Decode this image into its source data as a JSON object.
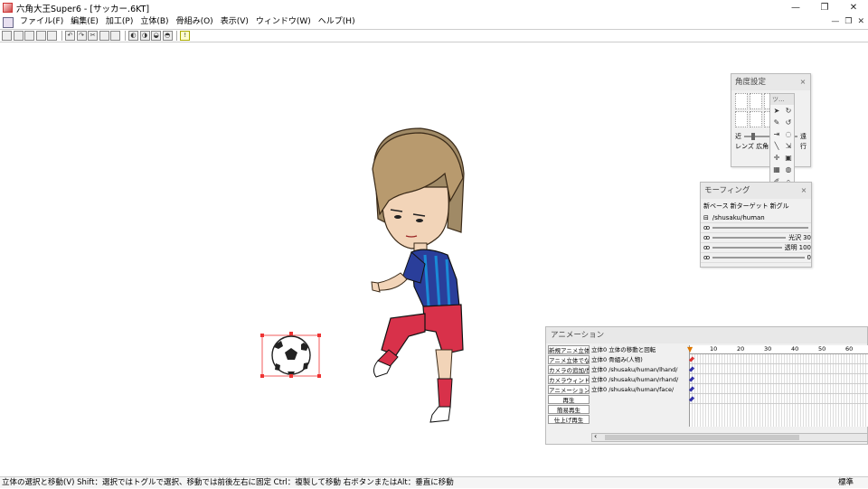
{
  "window": {
    "title": "六角大王Super6 - [サッカー.6KT]",
    "controls": [
      "—",
      "❐",
      "✕"
    ]
  },
  "menu": [
    "ファイル(F)",
    "編集(E)",
    "加工(P)",
    "立体(B)",
    "骨組み(O)",
    "表示(V)",
    "ウィンドウ(W)",
    "ヘルプ(H)"
  ],
  "mdi_controls": [
    "—",
    "❐",
    "✕"
  ],
  "toolbar_icons": [
    "new-icon",
    "open-icon",
    "save-icon",
    "save-all-icon",
    "print-icon",
    "undo-icon",
    "redo-icon",
    "cut-icon",
    "copy-icon",
    "paste-icon",
    "view1-icon",
    "view2-icon",
    "view3-icon",
    "view4-icon",
    "hint-icon"
  ],
  "angle_panel": {
    "title": "角度設定",
    "near_label": "近",
    "far_label": "遠",
    "lens_label": "レンズ 広角",
    "move_label": "行"
  },
  "tool_palette": {
    "title": "ツ..."
  },
  "morph_panel": {
    "title": "モーフィング",
    "tabs": [
      "新ベース",
      "新ターゲット",
      "新グル"
    ],
    "path": "/shusaku/human",
    "gloss_label": "光沢",
    "gloss_value": "30",
    "transparency_label": "透明",
    "transparency_value": "100",
    "last_value": "0"
  },
  "animation_panel": {
    "title": "アニメーション",
    "buttons": [
      "新規アニメ立体",
      "アニメ立体でなくす",
      "カメラの追加/削除",
      "カメラウィンドウに",
      "アニメーション設定",
      "再生",
      "簡易再生",
      "仕上げ再生"
    ],
    "tracks": [
      "立体0 立体の移動と回転",
      "立体0 骨組み(人物)",
      "立体0 /shusaku/human/lhand/",
      "立体0 /shusaku/human/rhand/",
      "立体0 /shusaku/human/face/"
    ],
    "ruler": [
      "10",
      "20",
      "30",
      "40",
      "50",
      "60"
    ]
  },
  "status": {
    "left": "立体の選択と移動(V)   Shift：選択ではトグルで選択、移動では前後左右に固定   Ctrl：複製して移動   右ボタンまたはAlt：垂直に移動",
    "right": "標準"
  },
  "colors": {
    "key_red": "#d33",
    "key_blue": "#33a",
    "selection": "#e33"
  }
}
